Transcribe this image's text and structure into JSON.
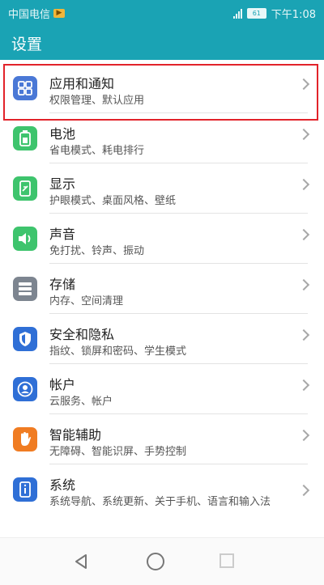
{
  "status_bar": {
    "carrier": "中国电信",
    "battery": "61",
    "time": "下午1:08"
  },
  "header": {
    "title": "设置"
  },
  "settings": [
    {
      "label": "应用和通知",
      "sub": "权限管理、默认应用",
      "icon": "apps-icon",
      "color": "#4a78d6"
    },
    {
      "label": "电池",
      "sub": "省电模式、耗电排行",
      "icon": "battery-icon",
      "color": "#3ec46d"
    },
    {
      "label": "显示",
      "sub": "护眼模式、桌面风格、壁纸",
      "icon": "display-icon",
      "color": "#3ec46d"
    },
    {
      "label": "声音",
      "sub": "免打扰、铃声、振动",
      "icon": "sound-icon",
      "color": "#3ec46d"
    },
    {
      "label": "存储",
      "sub": "内存、空间清理",
      "icon": "storage-icon",
      "color": "#7d8590"
    },
    {
      "label": "安全和隐私",
      "sub": "指纹、锁屏和密码、学生模式",
      "icon": "shield-icon",
      "color": "#2f6fd6"
    },
    {
      "label": "帐户",
      "sub": "云服务、帐户",
      "icon": "account-icon",
      "color": "#2f6fd6"
    },
    {
      "label": "智能辅助",
      "sub": "无障碍、智能识屏、手势控制",
      "icon": "hand-icon",
      "color": "#f07c22"
    },
    {
      "label": "系统",
      "sub": "系统导航、系统更新、关于手机、语言和输入法",
      "icon": "system-icon",
      "color": "#2f6fd6"
    }
  ],
  "colors": {
    "accent": "#1aa3b4",
    "highlight": "#e2232a"
  }
}
